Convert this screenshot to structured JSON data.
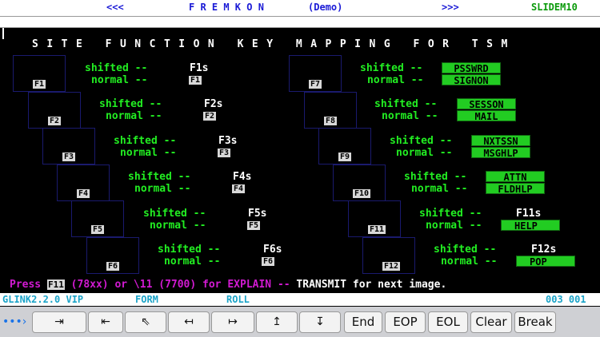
{
  "top_bar": {
    "prev": "<<<",
    "app_name": "F R E M K O N",
    "mode": "(Demo)",
    "next": ">>>",
    "screen_id": "SLIDEM10"
  },
  "title": "SITE FUNCTION KEY MAPPING FOR TSM",
  "shifted_label": "shifted --",
  "normal_label": "normal --",
  "left_keys": [
    {
      "key": "F1",
      "shifted": "F1s",
      "normal": "F1"
    },
    {
      "key": "F2",
      "shifted": "F2s",
      "normal": "F2"
    },
    {
      "key": "F3",
      "shifted": "F3s",
      "normal": "F3"
    },
    {
      "key": "F4",
      "shifted": "F4s",
      "normal": "F4"
    },
    {
      "key": "F5",
      "shifted": "F5s",
      "normal": "F5"
    },
    {
      "key": "F6",
      "shifted": "F6s",
      "normal": "F6"
    }
  ],
  "right_keys": [
    {
      "key": "F7",
      "shifted": "PSSWRD",
      "normal": "SIGNON"
    },
    {
      "key": "F8",
      "shifted": "SESSON",
      "normal": "MAIL"
    },
    {
      "key": "F9",
      "shifted": "NXTSSN",
      "normal": "MSGHLP"
    },
    {
      "key": "F10",
      "shifted": "ATTN",
      "normal": "FLDHLP"
    },
    {
      "key": "F11",
      "shifted": "F11s",
      "normal": "HELP"
    },
    {
      "key": "F12",
      "shifted": "F12s",
      "normal": "POP"
    }
  ],
  "prompt": {
    "press": "Press",
    "key": "F11",
    "rest": " (78xx) or \\11 (7700) for EXPLAIN --",
    "transmit": " TRANSMIT for next image."
  },
  "status_bar": {
    "version": "GLINK2.2.0 VIP",
    "mode": "FORM",
    "scroll": "ROLL",
    "position": "003 001"
  },
  "toolbar": {
    "more": "•••›",
    "buttons": [
      {
        "name": "tab-forward-button",
        "label": "⇥"
      },
      {
        "name": "tab-back-button",
        "label": "⇤"
      },
      {
        "name": "home-button",
        "label": "⇖"
      },
      {
        "name": "cursor-left-button",
        "label": "↤"
      },
      {
        "name": "cursor-right-button",
        "label": "↦"
      },
      {
        "name": "cursor-up-button",
        "label": "↥"
      },
      {
        "name": "cursor-down-button",
        "label": "↧"
      },
      {
        "name": "end-button",
        "label": "End"
      },
      {
        "name": "eop-button",
        "label": "EOP"
      },
      {
        "name": "eol-button",
        "label": "EOL"
      },
      {
        "name": "clear-button",
        "label": "Clear"
      },
      {
        "name": "break-button",
        "label": "Break"
      }
    ]
  },
  "colors": {
    "label_green": "#22ee22",
    "value_box_green": "#22cc22",
    "magenta": "#d21ad2",
    "header_blue": "#1a1ad6",
    "status_cyan": "#1aa3c8",
    "header_green": "#0a9a0a"
  }
}
